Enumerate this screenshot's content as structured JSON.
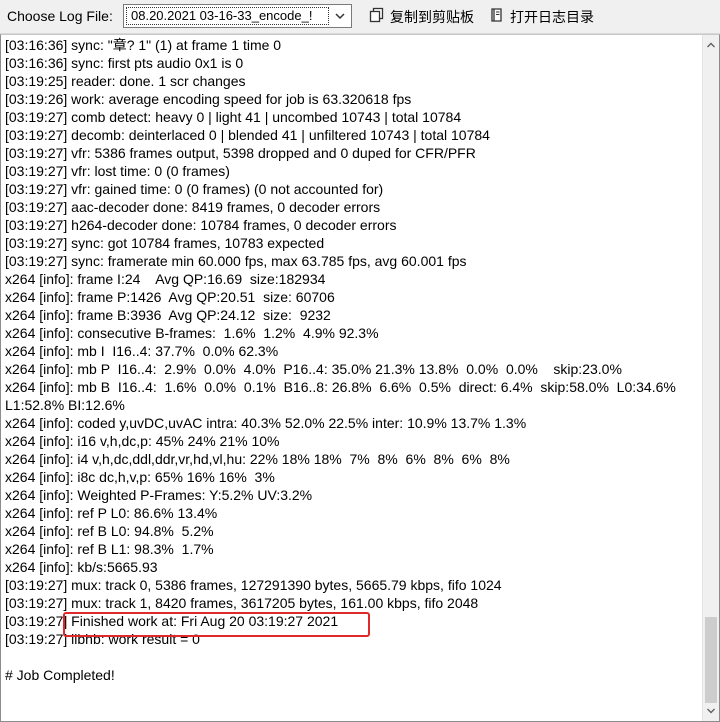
{
  "toolbar": {
    "choose_label": "Choose Log File:",
    "log_file_value": "08.20.2021 03-16-33_encode_!",
    "copy_label": "复制到剪贴板",
    "open_dir_label": "打开日志目录"
  },
  "log": {
    "lines": [
      "[03:16:36] sync: \"章? 1\" (1) at frame 1 time 0",
      "[03:16:36] sync: first pts audio 0x1 is 0",
      "[03:19:25] reader: done. 1 scr changes",
      "[03:19:26] work: average encoding speed for job is 63.320618 fps",
      "[03:19:27] comb detect: heavy 0 | light 41 | uncombed 10743 | total 10784",
      "[03:19:27] decomb: deinterlaced 0 | blended 41 | unfiltered 10743 | total 10784",
      "[03:19:27] vfr: 5386 frames output, 5398 dropped and 0 duped for CFR/PFR",
      "[03:19:27] vfr: lost time: 0 (0 frames)",
      "[03:19:27] vfr: gained time: 0 (0 frames) (0 not accounted for)",
      "[03:19:27] aac-decoder done: 8419 frames, 0 decoder errors",
      "[03:19:27] h264-decoder done: 10784 frames, 0 decoder errors",
      "[03:19:27] sync: got 10784 frames, 10783 expected",
      "[03:19:27] sync: framerate min 60.000 fps, max 63.785 fps, avg 60.001 fps",
      "x264 [info]: frame I:24    Avg QP:16.69  size:182934",
      "x264 [info]: frame P:1426  Avg QP:20.51  size: 60706",
      "x264 [info]: frame B:3936  Avg QP:24.12  size:  9232",
      "x264 [info]: consecutive B-frames:  1.6%  1.2%  4.9% 92.3%",
      "x264 [info]: mb I  I16..4: 37.7%  0.0% 62.3%",
      "x264 [info]: mb P  I16..4:  2.9%  0.0%  4.0%  P16..4: 35.0% 21.3% 13.8%  0.0%  0.0%    skip:23.0%",
      "x264 [info]: mb B  I16..4:  1.6%  0.0%  0.1%  B16..8: 26.8%  6.6%  0.5%  direct: 6.4%  skip:58.0%  L0:34.6%",
      "L1:52.8% BI:12.6%",
      "x264 [info]: coded y,uvDC,uvAC intra: 40.3% 52.0% 22.5% inter: 10.9% 13.7% 1.3%",
      "x264 [info]: i16 v,h,dc,p: 45% 24% 21% 10%",
      "x264 [info]: i4 v,h,dc,ddl,ddr,vr,hd,vl,hu: 22% 18% 18%  7%  8%  6%  8%  6%  8%",
      "x264 [info]: i8c dc,h,v,p: 65% 16% 16%  3%",
      "x264 [info]: Weighted P-Frames: Y:5.2% UV:3.2%",
      "x264 [info]: ref P L0: 86.6% 13.4%",
      "x264 [info]: ref B L0: 94.8%  5.2%",
      "x264 [info]: ref B L1: 98.3%  1.7%",
      "x264 [info]: kb/s:5665.93",
      "[03:19:27] mux: track 0, 5386 frames, 127291390 bytes, 5665.79 kbps, fifo 1024",
      "[03:19:27] mux: track 1, 8420 frames, 3617205 bytes, 161.00 kbps, fifo 2048",
      "[03:19:27] Finished work at: Fri Aug 20 03:19:27 2021",
      "[03:19:27] libhb: work result = 0",
      "",
      "# Job Completed!"
    ]
  },
  "colors": {
    "highlight": "#e02a2a",
    "window_bg": "#f0f0f0",
    "log_bg": "#ffffff"
  },
  "icons": {
    "copy": "copy-icon",
    "open_dir": "book-icon",
    "dropdown": "chevron-down-icon"
  }
}
